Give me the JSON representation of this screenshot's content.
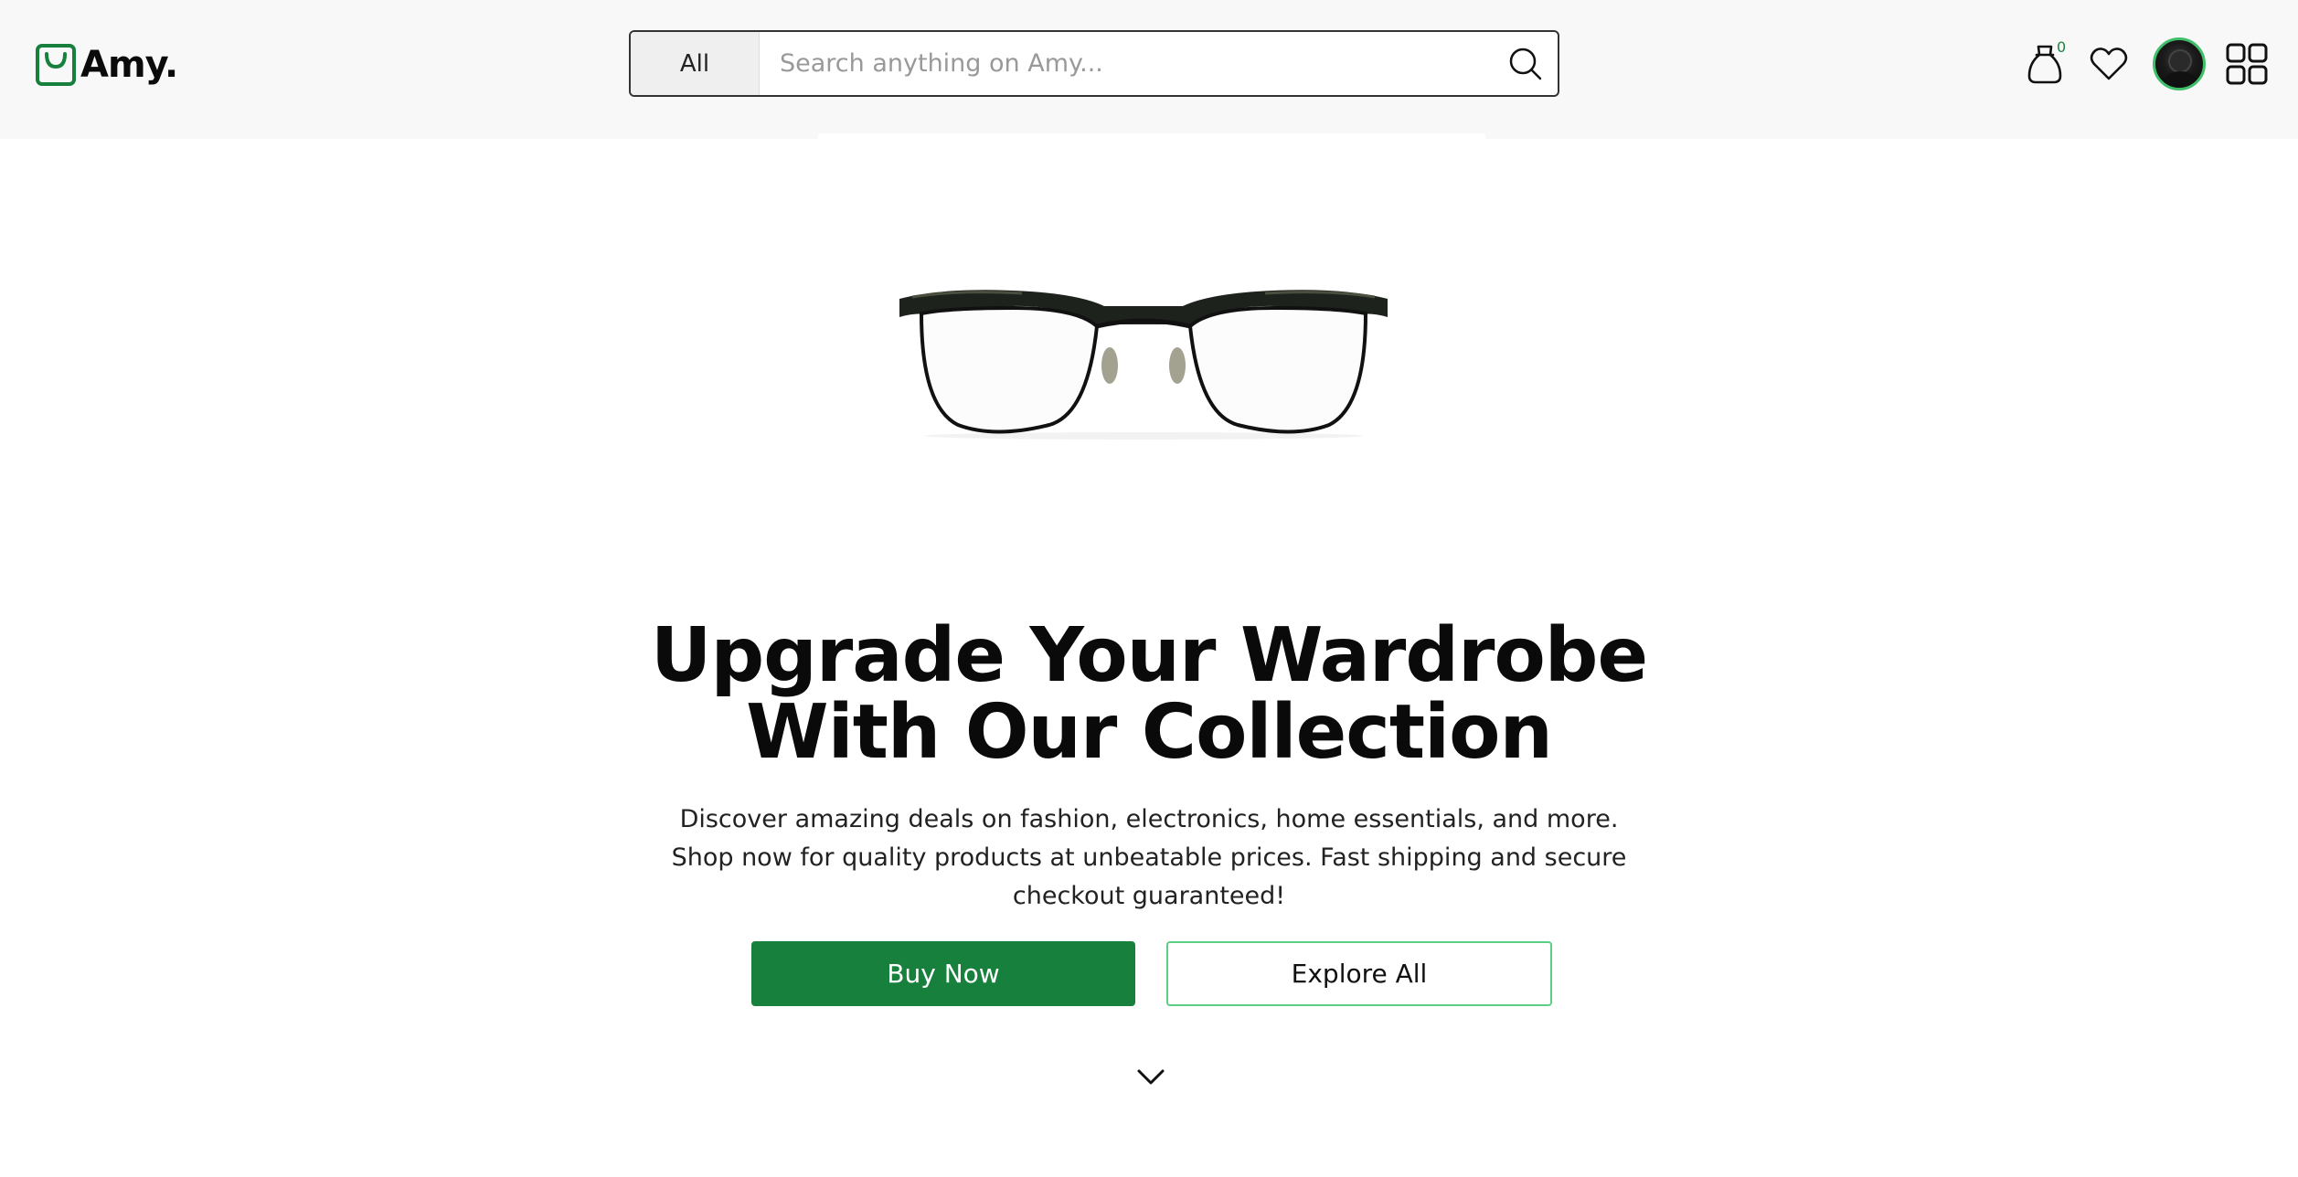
{
  "brand": {
    "name": "Amy.",
    "accent": "#17803d"
  },
  "search": {
    "category": "All",
    "placeholder": "Search anything on Amy..."
  },
  "nav": {
    "cart_count": "0",
    "icons": [
      "shopping-bag-icon",
      "heart-icon",
      "avatar",
      "grid-menu-icon"
    ]
  },
  "hero": {
    "headline_line1": "Upgrade Your Wardrobe",
    "headline_line2": "With Our Collection",
    "description": "Discover amazing deals on fashion, electronics, home essentials, and more. Shop now for quality products at unbeatable prices. Fast shipping and secure checkout guaranteed!",
    "primary_cta": "Buy Now",
    "secondary_cta": "Explore All",
    "image": "eyeglasses"
  }
}
